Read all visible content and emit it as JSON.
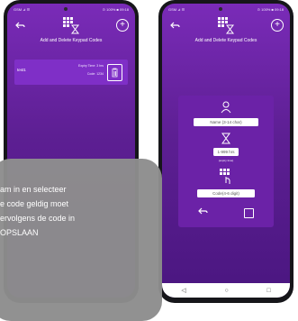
{
  "phone_left": {
    "status_left": "GSM ⊿ ☰",
    "status_right": "⊙ 100% ■ 09:18",
    "title": "Add and Delete Keypad Codes",
    "back_icon": "back-arrow-icon",
    "add_icon": "plus-circle-icon",
    "codes": [
      {
        "name": "test1",
        "expiry": "Expiry Time: 3 hrs",
        "code": "Code: 1234"
      }
    ]
  },
  "phone_right": {
    "status_left": "GSM ⊿ ☰",
    "status_right": "⊙ 100% ■ 09:18",
    "title": "Add and Delete Keypad Codes",
    "form": {
      "name_placeholder": "Name (3-14 char)",
      "time_value": "1-999 hrs",
      "time_hint": "(expiry time)",
      "code_placeholder": "Code(4-6 digit)"
    },
    "navbar": {
      "back": "◁",
      "home": "○",
      "recent": "□"
    }
  },
  "tooltip": {
    "lines": [
      "am in en selecteer",
      "e code geldig moet",
      "ervolgens de code in",
      "OPSLAAN"
    ]
  },
  "colors": {
    "purple_top": "#7a2bb8",
    "purple_bottom": "#4a1680",
    "tooltip_gray": "#8d8d8d"
  }
}
